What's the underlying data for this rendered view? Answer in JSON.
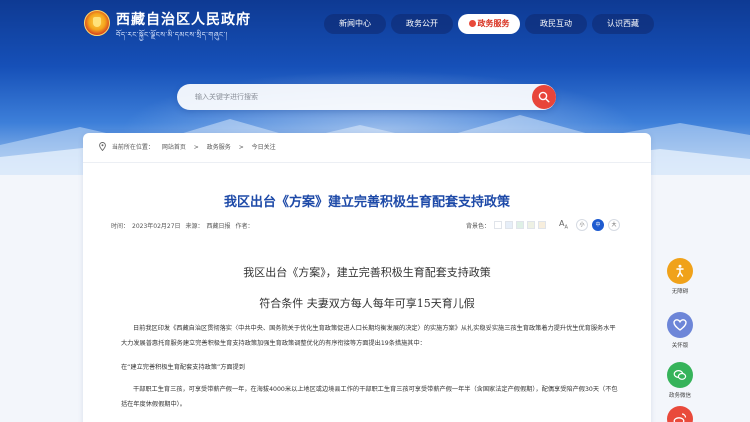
{
  "header": {
    "site_title": "西藏自治区人民政府",
    "site_subtitle": "བོད་རང་སྐྱོང་ལྗོངས་མི་དམངས་སྲིད་གཞུང་།",
    "nav": [
      {
        "label": "新闻中心",
        "active": false
      },
      {
        "label": "政务公开",
        "active": false
      },
      {
        "label": "政务服务",
        "active": true
      },
      {
        "label": "政民互动",
        "active": false
      },
      {
        "label": "认识西藏",
        "active": false
      }
    ]
  },
  "search": {
    "placeholder": "输入关键字进行搜索",
    "icon": "search-icon"
  },
  "breadcrumb": {
    "prefix": "当前所在位置：",
    "items": [
      "网站首页",
      "政务服务",
      "今日关注"
    ],
    "separator": ">"
  },
  "article": {
    "title": "我区出台《方案》建立完善积极生育配套支持政策",
    "meta": {
      "time_label": "时间：",
      "time": "2023年02月27日",
      "source_label": "来源：",
      "source": "西藏日报",
      "author_label": "作者："
    },
    "tools": {
      "theme_label": "背景色：",
      "theme_colors": [
        "#ffffff",
        "#e6eef8",
        "#dff0e6",
        "#eef1e4",
        "#f7eedd"
      ],
      "font_sizes": [
        "小",
        "中",
        "大"
      ],
      "font_active": 1
    },
    "heading": "我区出台《方案》，建立完善积极生育配套支持政策",
    "subheading": "符合条件 夫妻双方每人每年可享15天育儿假",
    "p1": "日前我区印发《西藏自治区贯彻落实〈中共中央、国务院关于优化生育政策促进人口长期均衡发展的决定〉的实施方案》从扎实稳妥实施三孩生育政策着力提升优生优育服务水平大力发展普惠托育服务建立完善积极生育支持政策加强生育政策调整优化的有序衔接等方面提出19条措施其中：",
    "p2": "在“建立完善积极生育配套支持政策”方面提到",
    "p3": "干部职工生育三孩，可享受带薪产假一年，在海拔4000米以上地区或边境县工作的干部职工生育三孩可享受带薪产假一年半（含国家法定产假假期），配偶享受陪产假30天（不包括在年度休假假期中）。"
  },
  "sidebar": [
    {
      "label": "无障碍",
      "icon": "accessibility-icon",
      "color": "#f0a21a"
    },
    {
      "label": "关怀版",
      "icon": "heart-icon",
      "color": "#6d86d8"
    },
    {
      "label": "政务微信",
      "icon": "wechat-icon",
      "color": "#36b35a"
    },
    {
      "label": "",
      "icon": "weibo-icon",
      "color": "#e94a3b"
    }
  ],
  "colors": {
    "accent_red": "#e8453a",
    "title_blue": "#1e4aa8"
  }
}
